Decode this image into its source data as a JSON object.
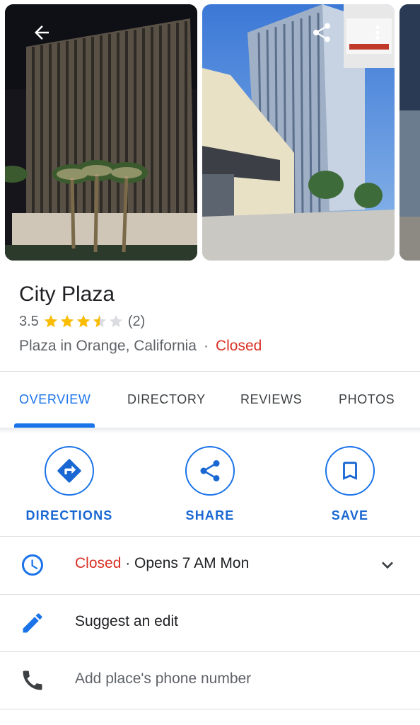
{
  "place": {
    "name": "City Plaza",
    "rating": "3.5",
    "rating_value": 3.5,
    "review_count": "(2)",
    "category": "Plaza in Orange, California",
    "separator": "·",
    "status": "Closed"
  },
  "tabs": [
    {
      "label": "OVERVIEW",
      "active": true
    },
    {
      "label": "DIRECTORY"
    },
    {
      "label": "REVIEWS"
    },
    {
      "label": "PHOTOS"
    }
  ],
  "actions": [
    {
      "label": "DIRECTIONS",
      "icon": "directions-icon"
    },
    {
      "label": "SHARE",
      "icon": "share-icon"
    },
    {
      "label": "SAVE",
      "icon": "bookmark-icon"
    }
  ],
  "hours": {
    "status": "Closed",
    "detail": " · Opens 7 AM Mon",
    "icon": "clock-icon"
  },
  "suggest_edit": {
    "label": "Suggest an edit",
    "icon": "pencil-icon"
  },
  "phone": {
    "label": "Add place's phone number",
    "icon": "phone-icon"
  },
  "colors": {
    "accent": "#1a73e8",
    "closed": "#d93025",
    "star": "#fbbc04",
    "text_secondary": "#5f6368"
  }
}
